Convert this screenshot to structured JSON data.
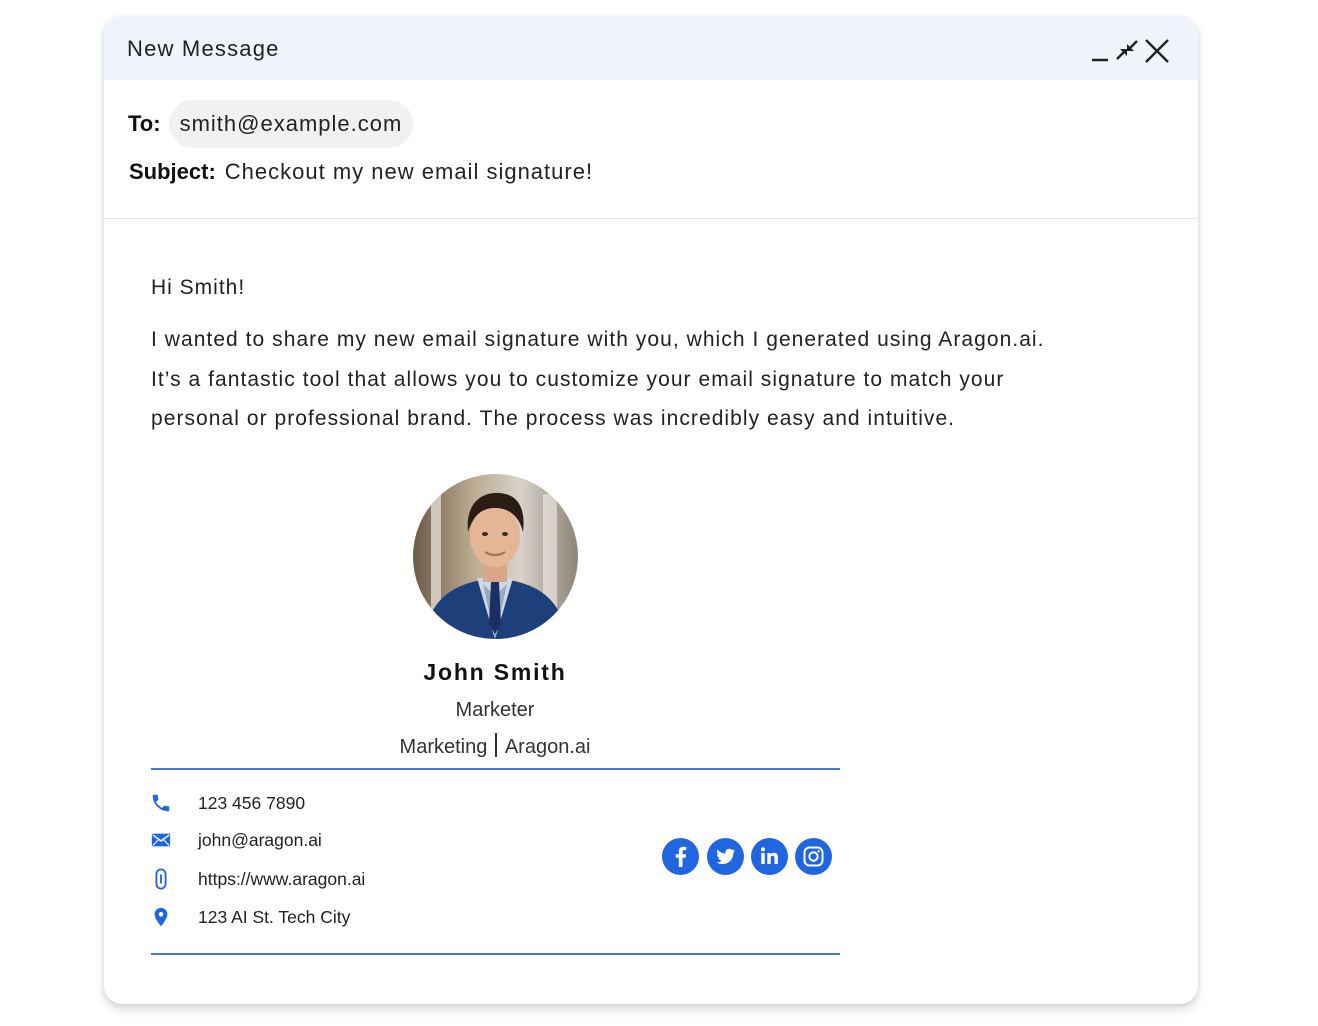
{
  "window": {
    "title": "New Message",
    "controls": [
      "minimize-icon",
      "collapse-icon",
      "close-icon"
    ]
  },
  "header": {
    "to_label": "To:",
    "to_value": "smith@example.com",
    "subject_label": "Subject:",
    "subject_value": "Checkout my new email signature!"
  },
  "body": {
    "greeting": "Hi Smith!",
    "lines": [
      "I wanted to share my new email signature with you, which I generated using Aragon.ai.",
      "It’s a fantastic tool that allows you to customize your email signature to match your",
      "personal or professional brand. The process was incredibly easy and intuitive."
    ]
  },
  "signature": {
    "name": "John Smith",
    "role": "Marketer",
    "department": "Marketing",
    "company": "Aragon.ai",
    "phone": "123 456 7890",
    "email": "john@aragon.ai",
    "website": "https://www.aragon.ai",
    "address": "123 AI St. Tech City",
    "social": [
      "facebook-icon",
      "twitter-icon",
      "linkedin-icon",
      "instagram-icon"
    ]
  },
  "colors": {
    "accent": "#1f66e0",
    "divider": "#3f79de",
    "titlebar": "#eef3fc"
  }
}
